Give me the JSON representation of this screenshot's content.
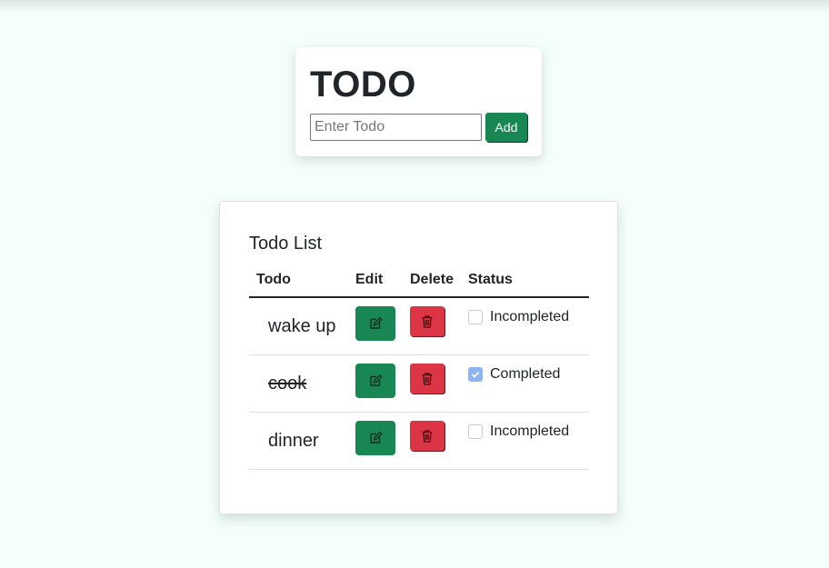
{
  "header": {
    "title": "TODO",
    "input_value": "",
    "input_placeholder": "Enter Todo",
    "add_label": "Add"
  },
  "list": {
    "title": "Todo List",
    "columns": {
      "todo": "Todo",
      "edit": "Edit",
      "delete": "Delete",
      "status": "Status"
    },
    "rows": [
      {
        "text": "wake up",
        "completed": false,
        "status": "Incompleted"
      },
      {
        "text": "cook",
        "completed": true,
        "status": "Completed"
      },
      {
        "text": "dinner",
        "completed": false,
        "status": "Incompleted"
      }
    ]
  },
  "icons": {
    "edit": "edit-icon",
    "delete": "trash-icon",
    "check": "check-icon"
  },
  "colors": {
    "background": "#f4fffa",
    "success": "#198754",
    "danger": "#dc3545",
    "checkbox_checked": "#8cb4f3"
  }
}
